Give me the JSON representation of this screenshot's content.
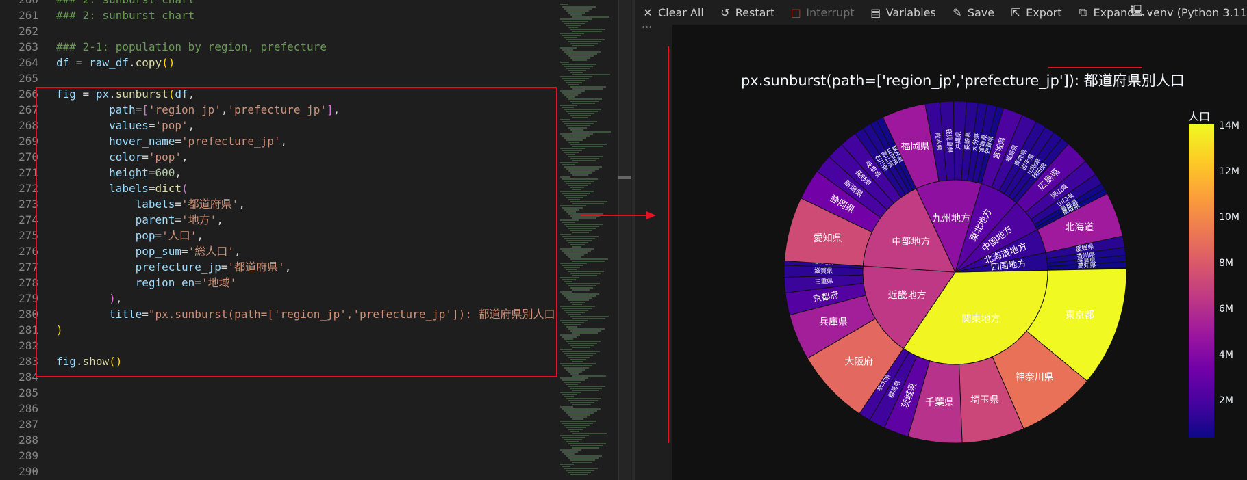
{
  "editor": {
    "lines": [
      {
        "n": "260",
        "html": "<span class='c-com'>### 2: sunburst chart</span>"
      },
      {
        "n": "261",
        "html": "<span class='c-com'>### 2: sunburst chart</span>"
      },
      {
        "n": "262",
        "html": ""
      },
      {
        "n": "263",
        "html": "<span class='c-com'>### 2-1: population by region, prefecture</span>"
      },
      {
        "n": "264",
        "html": "<span class='c-var'>df</span> = <span class='c-var'>raw_df</span>.<span class='c-fn'>copy</span><span class='c-punc'>()</span>"
      },
      {
        "n": "265",
        "html": ""
      },
      {
        "n": "266",
        "html": "<span class='c-var'>fig</span> = <span class='c-var'>px</span>.<span class='c-fn'>sunburst</span><span class='c-punc'>(</span><span class='c-var'>df</span>,"
      },
      {
        "n": "267",
        "html": "        <span class='c-var'>path</span>=<span class='c-pur'>[</span><span class='c-str'>'region_jp'</span>,<span class='c-str'>'prefecture_jp'</span><span class='c-pur'>]</span>,"
      },
      {
        "n": "268",
        "html": "        <span class='c-var'>values</span>=<span class='c-str'>'pop'</span>,"
      },
      {
        "n": "269",
        "html": "        <span class='c-var'>hover_name</span>=<span class='c-str'>'prefecture_jp'</span>,"
      },
      {
        "n": "270",
        "html": "        <span class='c-var'>color</span>=<span class='c-str'>'pop'</span>,"
      },
      {
        "n": "271",
        "html": "        <span class='c-var'>height</span>=<span class='c-num'>600</span>,"
      },
      {
        "n": "272",
        "html": "        <span class='c-var'>labels</span>=<span class='c-fn'>dict</span><span class='c-pur'>(</span>"
      },
      {
        "n": "273",
        "html": "            <span class='c-var'>labels</span>=<span class='c-str'>'都道府県'</span>,"
      },
      {
        "n": "274",
        "html": "            <span class='c-var'>parent</span>=<span class='c-str'>'地方'</span>,"
      },
      {
        "n": "275",
        "html": "            <span class='c-var'>pop</span>=<span class='c-str'>'人口'</span>,"
      },
      {
        "n": "276",
        "html": "            <span class='c-var'>pop_sum</span>=<span class='c-str'>'総人口'</span>,"
      },
      {
        "n": "277",
        "html": "            <span class='c-var'>prefecture_jp</span>=<span class='c-str'>'都道府県'</span>,"
      },
      {
        "n": "278",
        "html": "            <span class='c-var'>region_en</span>=<span class='c-str'>'地域'</span>"
      },
      {
        "n": "279",
        "html": "        <span class='c-pur'>)</span>,"
      },
      {
        "n": "280",
        "html": "        <span class='c-var'>title</span>=<span class='c-str'>\"px.sunburst(path=['region_jp','prefecture_jp']): 都道府県別人口\"</span>"
      },
      {
        "n": "281",
        "html": "<span class='c-punc'>)</span>"
      },
      {
        "n": "282",
        "html": ""
      },
      {
        "n": "283",
        "html": "<span class='c-var'>fig</span>.<span class='c-fn'>show</span><span class='c-punc'>()</span>"
      },
      {
        "n": "284",
        "html": ""
      },
      {
        "n": "285",
        "html": ""
      },
      {
        "n": "286",
        "html": ""
      },
      {
        "n": "287",
        "html": ""
      },
      {
        "n": "288",
        "html": ""
      },
      {
        "n": "289",
        "html": ""
      },
      {
        "n": "290",
        "html": ""
      }
    ]
  },
  "toolbar": {
    "clear_all": "Clear All",
    "restart": "Restart",
    "interrupt": "Interrupt",
    "variables": "Variables",
    "save": "Save",
    "export": "Export",
    "expand": "Expand",
    "more": "···",
    "kernel": "venv (Python 3.11"
  },
  "output": {
    "dots": "···",
    "title": "px.sunburst(path=['region_jp','prefecture_jp']): 都道府県別人口",
    "colorbar_title": "人口",
    "colorbar_ticks": [
      "14M",
      "12M",
      "10M",
      "8M",
      "6M",
      "4M",
      "2M"
    ]
  },
  "colors": {
    "accent_red": "#e81123"
  },
  "chart_data": {
    "type": "sunburst",
    "title": "px.sunburst(path=['region_jp','prefecture_jp']): 都道府県別人口",
    "colorbar": {
      "title": "人口",
      "ticks": [
        "14M",
        "12M",
        "10M",
        "8M",
        "6M",
        "4M",
        "2M"
      ],
      "colorscale": "plasma"
    },
    "regions": [
      {
        "label": "関東地方",
        "value": 43.0,
        "prefectures": [
          {
            "label": "東京都",
            "value": 14.0
          },
          {
            "label": "神奈川県",
            "value": 9.2
          },
          {
            "label": "埼玉県",
            "value": 7.3
          },
          {
            "label": "千葉県",
            "value": 6.3
          },
          {
            "label": "茨城県",
            "value": 2.9
          },
          {
            "label": "群馬県",
            "value": 1.9
          },
          {
            "label": "栃木県",
            "value": 1.9
          }
        ]
      },
      {
        "label": "近畿地方",
        "value": 20.5,
        "prefectures": [
          {
            "label": "大阪府",
            "value": 8.8
          },
          {
            "label": "兵庫県",
            "value": 5.4
          },
          {
            "label": "京都府",
            "value": 2.6
          },
          {
            "label": "三重県",
            "value": 1.8
          },
          {
            "label": "滋賀県",
            "value": 1.4
          },
          {
            "label": "奈良県",
            "value": 1.3
          },
          {
            "label": "和歌山県",
            "value": 0.9
          }
        ]
      },
      {
        "label": "中部地方",
        "value": 21.0,
        "prefectures": [
          {
            "label": "愛知県",
            "value": 7.5
          },
          {
            "label": "静岡県",
            "value": 3.6
          },
          {
            "label": "新潟県",
            "value": 2.2
          },
          {
            "label": "長野県",
            "value": 2.0
          },
          {
            "label": "岐阜県",
            "value": 2.0
          },
          {
            "label": "石川県",
            "value": 1.1
          },
          {
            "label": "富山県",
            "value": 1.0
          },
          {
            "label": "山梨県",
            "value": 0.8
          },
          {
            "label": "福井県",
            "value": 0.8
          }
        ]
      },
      {
        "label": "九州地方",
        "value": 14.2,
        "prefectures": [
          {
            "label": "福岡県",
            "value": 5.1
          },
          {
            "label": "熊本県",
            "value": 1.7
          },
          {
            "label": "鹿児島県",
            "value": 1.6
          },
          {
            "label": "沖縄県",
            "value": 1.5
          },
          {
            "label": "長崎県",
            "value": 1.3
          },
          {
            "label": "大分県",
            "value": 1.1
          },
          {
            "label": "宮崎県",
            "value": 1.1
          },
          {
            "label": "佐賀県",
            "value": 0.8
          }
        ]
      },
      {
        "label": "東北地方",
        "value": 8.6,
        "prefectures": [
          {
            "label": "宮城県",
            "value": 2.3
          },
          {
            "label": "福島県",
            "value": 1.8
          },
          {
            "label": "青森県",
            "value": 1.2
          },
          {
            "label": "岩手県",
            "value": 1.2
          },
          {
            "label": "山形県",
            "value": 1.1
          },
          {
            "label": "秋田県",
            "value": 1.0
          }
        ]
      },
      {
        "label": "中国地方",
        "value": 7.3,
        "prefectures": [
          {
            "label": "広島県",
            "value": 2.8
          },
          {
            "label": "岡山県",
            "value": 1.9
          },
          {
            "label": "山口県",
            "value": 1.3
          },
          {
            "label": "島根県",
            "value": 0.7
          },
          {
            "label": "鳥取県",
            "value": 0.6
          }
        ]
      },
      {
        "label": "北海道地方",
        "value": 5.2,
        "prefectures": [
          {
            "label": "北海道",
            "value": 5.2
          }
        ]
      },
      {
        "label": "四国地方",
        "value": 3.8,
        "prefectures": [
          {
            "label": "愛媛県",
            "value": 1.3
          },
          {
            "label": "香川県",
            "value": 0.95
          },
          {
            "label": "徳島県",
            "value": 0.72
          },
          {
            "label": "高知県",
            "value": 0.69
          }
        ]
      }
    ]
  }
}
